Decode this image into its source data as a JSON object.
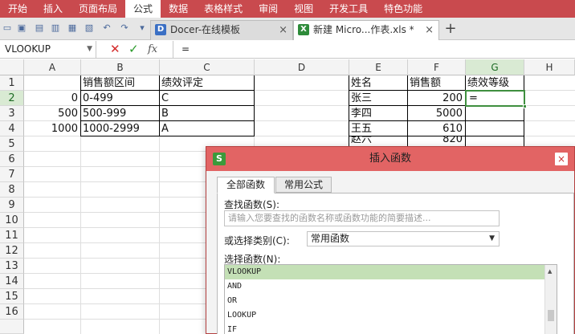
{
  "menu": {
    "items": [
      "开始",
      "插入",
      "页面布局",
      "公式",
      "数据",
      "表格样式",
      "审阅",
      "视图",
      "开发工具",
      "特色功能"
    ],
    "active_index": 3
  },
  "tabs": [
    {
      "label": "Docer-在线模板",
      "close": "×",
      "icon": "docer-icon"
    },
    {
      "label": "新建 Micro...作表.xls *",
      "close": "×",
      "icon": "excel-file-icon"
    }
  ],
  "new_tab_symbol": "+",
  "formula_bar": {
    "name_box": "VLOOKUP",
    "cancel_symbol": "✕",
    "enter_symbol": "✓",
    "fx_label": "fx",
    "content": "="
  },
  "grid": {
    "columns": [
      "A",
      "B",
      "C",
      "D",
      "E",
      "F",
      "G",
      "H"
    ],
    "selected_column": "G",
    "rows": [
      "1",
      "2",
      "3",
      "4",
      "5",
      "6",
      "7",
      "8",
      "9",
      "10",
      "11",
      "12",
      "13",
      "14",
      "15",
      "16"
    ],
    "selected_row": "2",
    "cells": {
      "B1": "销售额区间",
      "C1": "绩效评定",
      "A2": "0",
      "B2": "0-499",
      "C2": "C",
      "A3": "500",
      "B3": "500-999",
      "C3": "B",
      "A4": "1000",
      "B4": "1000-2999",
      "C4": "A",
      "E1": "姓名",
      "F1": "销售额",
      "G1": "绩效等级",
      "E2": "张三",
      "F2": "200",
      "G2": "=",
      "E3": "李四",
      "F3": "5000",
      "E4": "王五",
      "F4": "610",
      "E5": "赵六",
      "F5": "820"
    }
  },
  "dialog": {
    "title": "插入函数",
    "logo": "S",
    "close": "×",
    "tabs": [
      "全部函数",
      "常用公式"
    ],
    "search_label": "查找函数(S):",
    "search_placeholder": "请输入您要查找的函数名称或函数功能的简要描述...",
    "category_label": "或选择类别(C):",
    "category_value": "常用函数",
    "list_label": "选择函数(N):",
    "functions": [
      "VLOOKUP",
      "AND",
      "OR",
      "LOOKUP",
      "IF"
    ],
    "selected_function": "VLOOKUP"
  },
  "colors": {
    "ribbon": "#c94a4e",
    "dialog_title": "#e26464",
    "selection": "#3f8f3f",
    "selected_item": "#c4e0b6"
  }
}
